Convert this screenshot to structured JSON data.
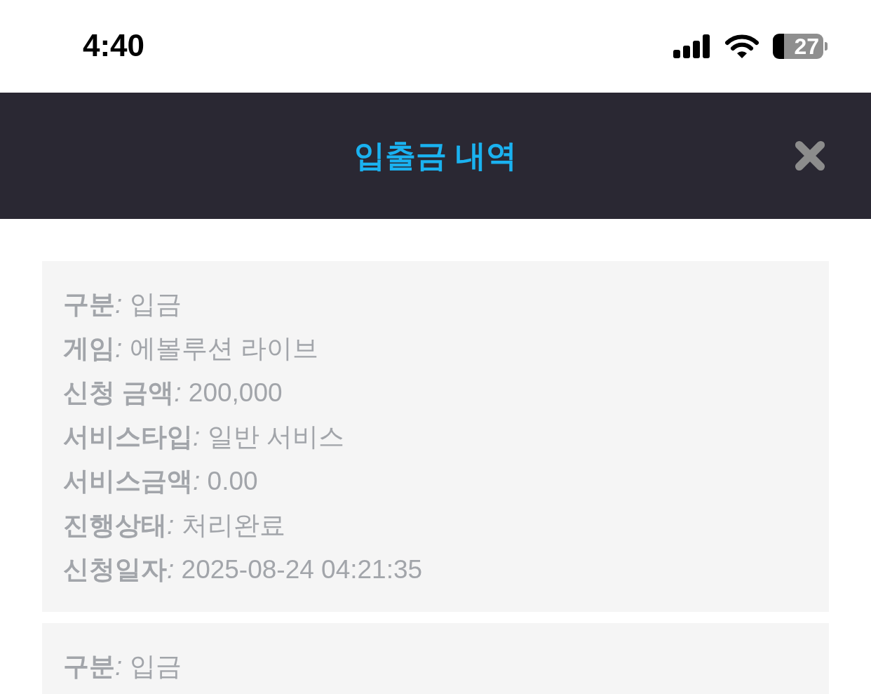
{
  "status_bar": {
    "time": "4:40",
    "battery": "27"
  },
  "header": {
    "title": "입출금 내역"
  },
  "cards": [
    {
      "rows": [
        {
          "label": "구분",
          "value": "*:* 입금"
        },
        {
          "label": "게임",
          "value": "*:* 에볼루션 라이브"
        },
        {
          "label": "신청 금액",
          "value": "*:* 200,000"
        },
        {
          "label": "서비스타입",
          "value": "*:* 일반 서비스"
        },
        {
          "label": "서비스금액",
          "value": "*:* 0.00"
        },
        {
          "label": "진행상태",
          "value": "*:* 처리완료"
        },
        {
          "label": "신청일자",
          "value": "*:* 2025-08-24 04:21:35"
        }
      ]
    },
    {
      "rows": [
        {
          "label": "구분",
          "value": "*:* 입금"
        }
      ]
    }
  ]
}
